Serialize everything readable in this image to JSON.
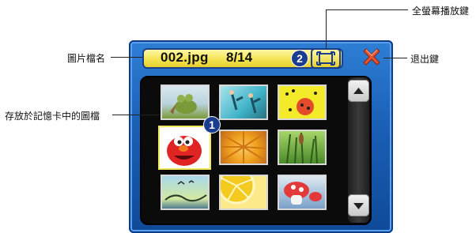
{
  "viewer": {
    "file_name": "002.jpg",
    "page_count": "8/14"
  },
  "badges": {
    "one": "1",
    "two": "2"
  },
  "callouts": {
    "fullscreen": "全螢幕播放鍵",
    "filename": "圖片檔名",
    "exit": "退出鍵",
    "images": "存放於記憶卡中的圖檔"
  },
  "icons": {
    "fullscreen": "fullscreen-icon",
    "close": "close-x-icon",
    "scroll_up": "arrow-up-icon",
    "scroll_down": "arrow-down-icon"
  },
  "thumbnails": [
    {
      "name": "frog-cartoon",
      "colors": [
        "#d9e8ef",
        "#7a9a3a",
        "#8b6b3a"
      ]
    },
    {
      "name": "swimmers-teal",
      "colors": [
        "#3fb3c8",
        "#a8e3ec",
        "#2a6f80"
      ]
    },
    {
      "name": "yellow-ladybug",
      "colors": [
        "#f3ea2a",
        "#e44b2a",
        "#2d2d2d"
      ]
    },
    {
      "name": "red-monster",
      "colors": [
        "#ffffff",
        "#e02424",
        "#222222"
      ]
    },
    {
      "name": "orange-flower",
      "colors": [
        "#f0a21e",
        "#c0661a",
        "#f5c966"
      ]
    },
    {
      "name": "green-grass",
      "colors": [
        "#4b8a2a",
        "#a7d46a",
        "#2f5a18"
      ]
    },
    {
      "name": "blue-landscape",
      "colors": [
        "#a9d7ec",
        "#d2e9a0",
        "#4f7d8f"
      ]
    },
    {
      "name": "lemon-slice",
      "colors": [
        "#f4c920",
        "#fbe98a",
        "#c9b045"
      ]
    },
    {
      "name": "mushroom-cartoon",
      "colors": [
        "#e23a3a",
        "#ffffff",
        "#7aa0c8"
      ]
    }
  ]
}
